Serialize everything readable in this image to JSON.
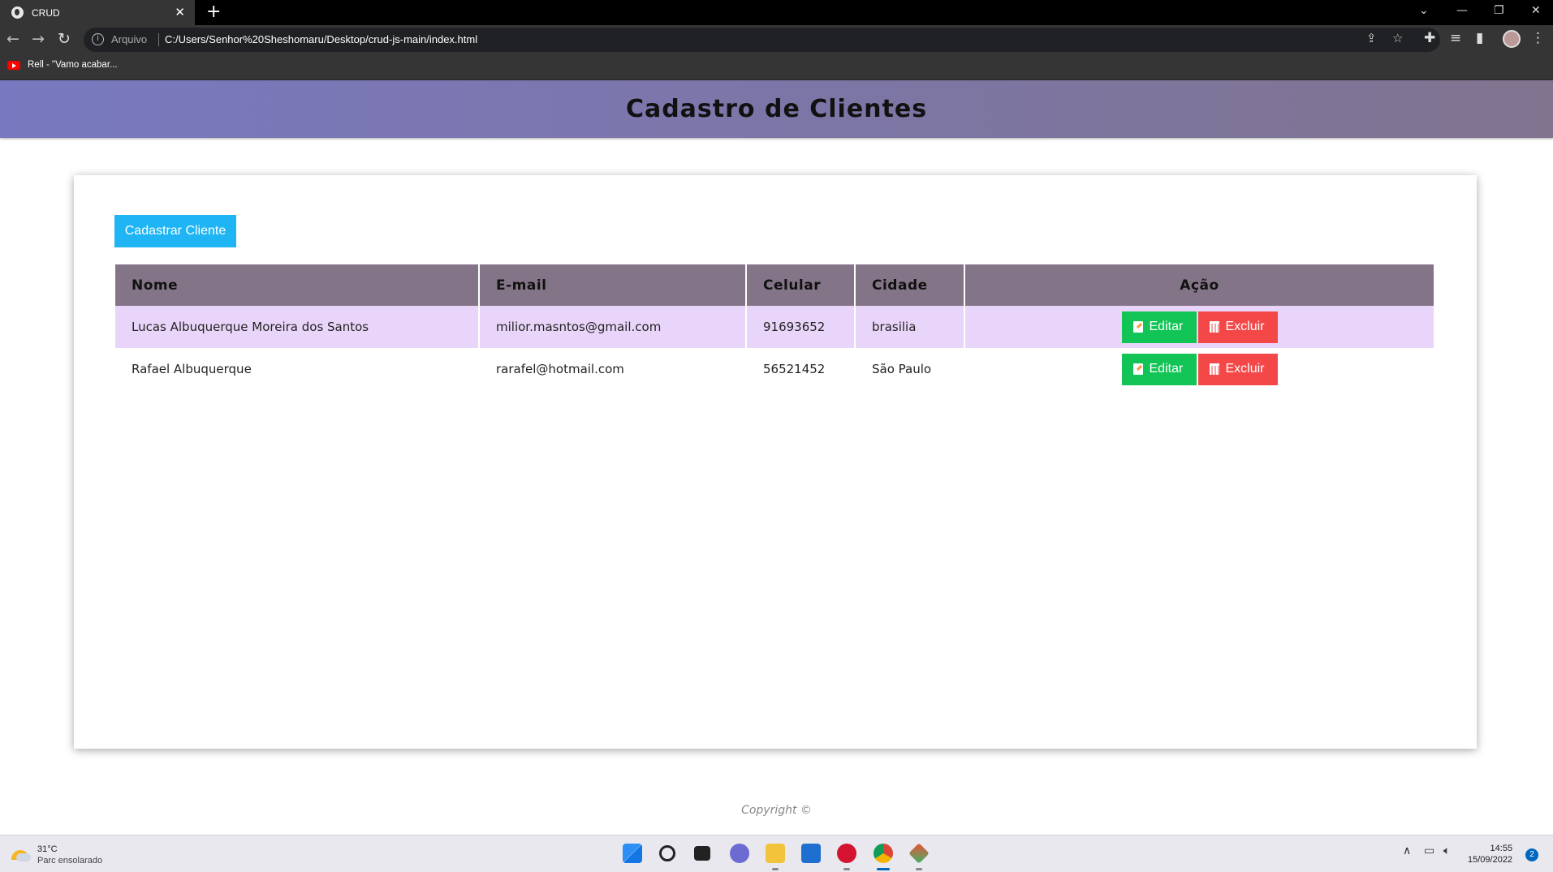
{
  "browser": {
    "tab_title": "CRUD",
    "tab_close": "✕",
    "new_tab": "+",
    "address_label": "Arquivo",
    "url": "C:/Users/Senhor%20Sheshomaru/Desktop/crud-js-main/index.html",
    "bookmark": "Rell - \"Vamo acabar..."
  },
  "page": {
    "title": "Cadastro de Clientes",
    "new_button": "Cadastrar Cliente",
    "footer": "Copyright ©"
  },
  "table": {
    "headers": [
      "Nome",
      "E-mail",
      "Celular",
      "Cidade",
      "Ação"
    ],
    "rows": [
      {
        "nome": "Lucas Albuquerque Moreira dos Santos",
        "email": "milior.masntos@gmail.com",
        "celular": "91693652",
        "cidade": "brasilia"
      },
      {
        "nome": "Rafael Albuquerque",
        "email": "rarafel@hotmail.com",
        "celular": "56521452",
        "cidade": "São Paulo"
      }
    ],
    "edit_label": "Editar",
    "delete_label": "Excluir"
  },
  "taskbar": {
    "temperature": "31°C",
    "weather": "Parc ensolarado",
    "time": "14:55",
    "date": "15/09/2022",
    "notifications": "2"
  },
  "colors": {
    "header_gradient_start": "#7878c0",
    "header_gradient_end": "#80748f",
    "table_header": "#847488",
    "row_highlight": "#ead5fa",
    "new_button": "#1fb5f4",
    "edit_button": "#12c455",
    "delete_button": "#f44848"
  }
}
